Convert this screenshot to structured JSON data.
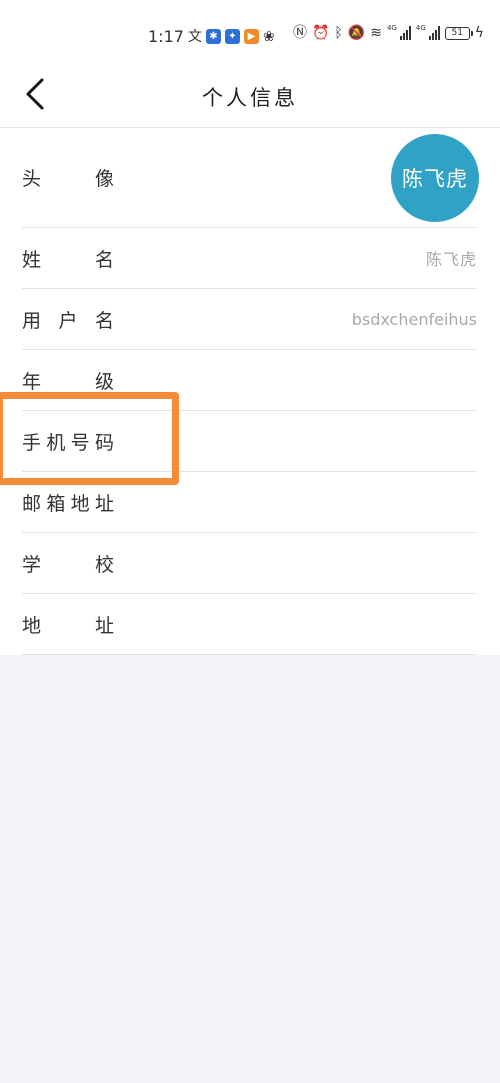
{
  "status_bar": {
    "time": "1:17",
    "left_icons": [
      "translate-icon",
      "message-icon",
      "star-app-icon",
      "play-app-icon",
      "paw-icon"
    ],
    "right_icons": [
      "nfc-icon",
      "alarm-icon",
      "bluetooth-icon",
      "mute-icon",
      "wifi-icon",
      "signal-icon",
      "signal-icon",
      "charging-icon"
    ],
    "network_1": "4G",
    "network_2": "4G",
    "battery": "51",
    "colors": {
      "message_app": "#2d6fd6",
      "star_app": "#2d6fd6",
      "play_app": "#f08a2a"
    }
  },
  "nav": {
    "title": "个人信息",
    "back_icon": "chevron-left-icon"
  },
  "profile": {
    "rows": [
      {
        "label": "头 像",
        "avatar_text": "陈飞虎"
      },
      {
        "label": "姓 名",
        "value": "陈飞虎"
      },
      {
        "label": "用户名",
        "value": "bsdxchenfeihus"
      },
      {
        "label": "年 级",
        "value": ""
      },
      {
        "label": "手机号码",
        "value": ""
      },
      {
        "label": "邮箱地址",
        "value": ""
      },
      {
        "label": "学 校",
        "value": ""
      },
      {
        "label": "地 址",
        "value": ""
      }
    ]
  },
  "colors": {
    "avatar_bg": "#2fa2c6",
    "highlight": "#f28c3a",
    "page_bg": "#f2f3f7",
    "value_text": "#a8a8a8"
  }
}
